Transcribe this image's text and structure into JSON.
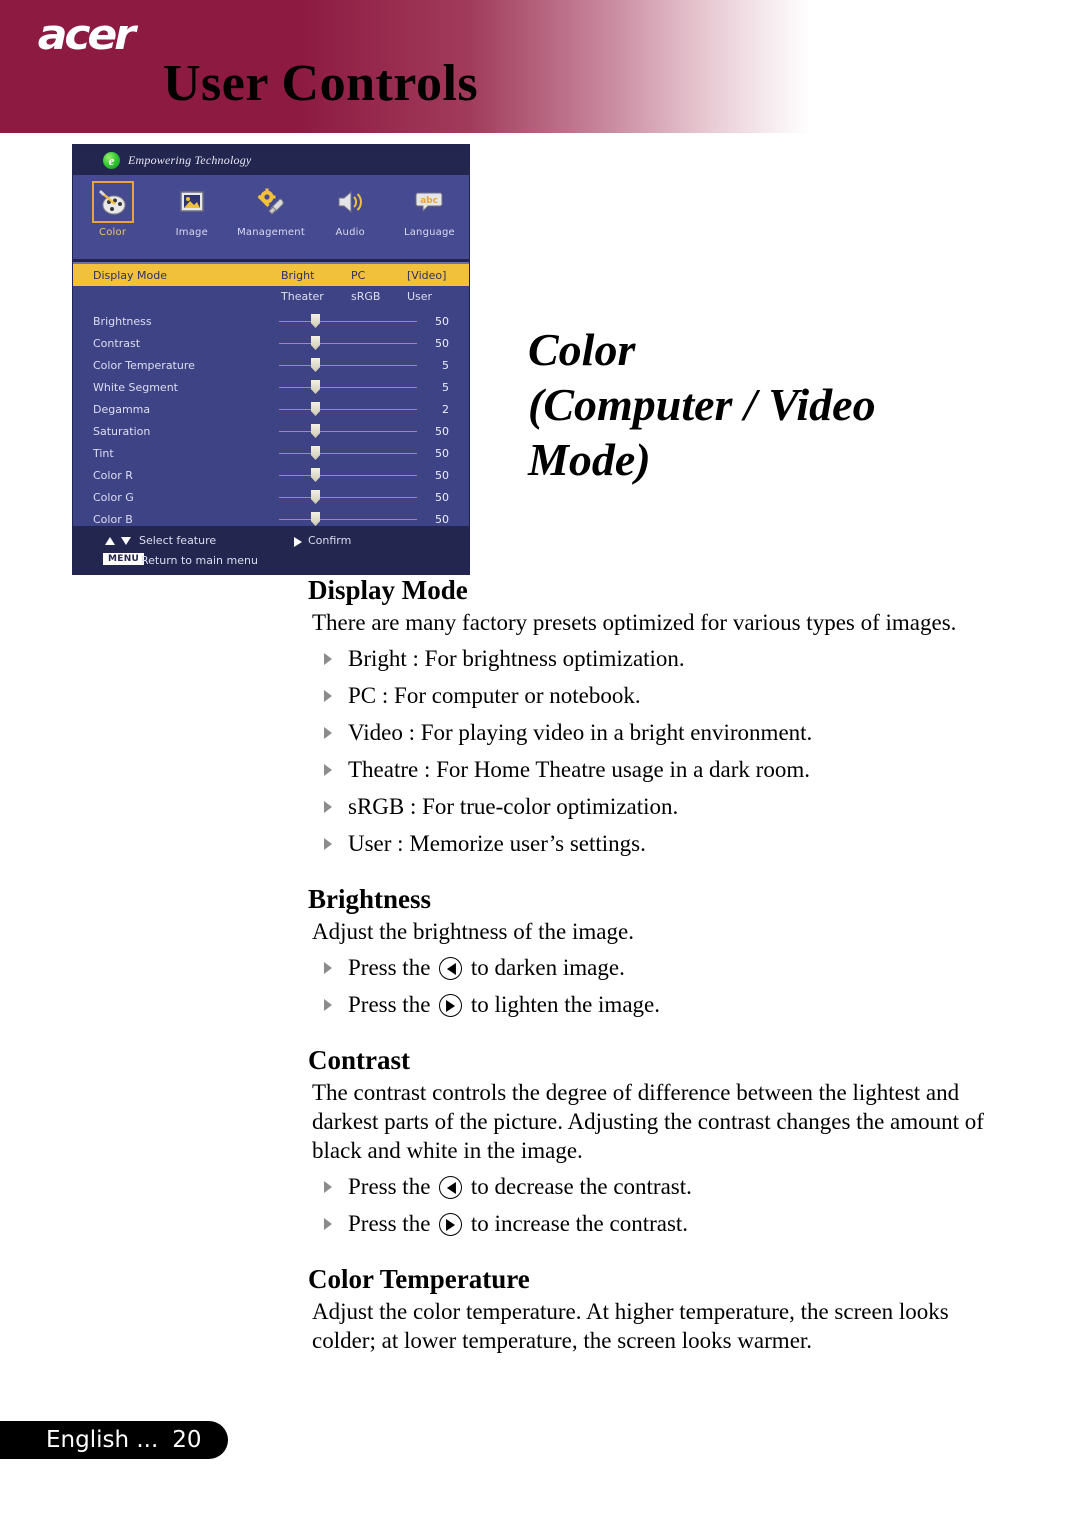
{
  "header": {
    "brand": "acer",
    "title": "User Controls"
  },
  "osd": {
    "brand_logo_letter": "e",
    "brand_text": "Empowering Technology",
    "tabs": [
      {
        "label": "Color",
        "icon": "palette-icon",
        "selected": true
      },
      {
        "label": "Image",
        "icon": "picture-icon",
        "selected": false
      },
      {
        "label": "Management",
        "icon": "gear-wrench-icon",
        "selected": false
      },
      {
        "label": "Audio",
        "icon": "speaker-icon",
        "selected": false
      },
      {
        "label": "Language",
        "icon": "abc-bubble-icon",
        "selected": false
      }
    ],
    "display_mode": {
      "label": "Display Mode",
      "options_row1": [
        "Bright",
        "PC",
        "[Video]"
      ],
      "options_row2": [
        "Theater",
        "sRGB",
        "User"
      ],
      "selected": "[Video]"
    },
    "sliders": [
      {
        "label": "Brightness",
        "value": "50"
      },
      {
        "label": "Contrast",
        "value": "50"
      },
      {
        "label": "Color Temperature",
        "value": "5"
      },
      {
        "label": "White Segment",
        "value": "5"
      },
      {
        "label": "Degamma",
        "value": "2"
      },
      {
        "label": "Saturation",
        "value": "50"
      },
      {
        "label": "Tint",
        "value": "50"
      },
      {
        "label": "Color R",
        "value": "50"
      },
      {
        "label": "Color G",
        "value": "50"
      },
      {
        "label": "Color B",
        "value": "50"
      }
    ],
    "footer": {
      "select_feature": "Select feature",
      "confirm": "Confirm",
      "menu_badge": "MENU",
      "return_main": "Return to main menu"
    },
    "colors": {
      "panel_bg": "#3e4386",
      "bar_bg": "#23264f",
      "highlight": "#f2c13c",
      "selection_border": "#e8a33d"
    }
  },
  "page_title": {
    "line1": "Color",
    "line2": "(Computer / Video",
    "line3": "Mode)"
  },
  "sections": [
    {
      "heading": "Display Mode",
      "paragraph": "There are many factory presets optimized for various types of images.",
      "bullets": [
        "Bright : For brightness optimization.",
        "PC : For computer or notebook.",
        "Video : For playing video in a bright environment.",
        "Theatre : For Home Theatre usage in a dark room.",
        "sRGB : For true-color optimization.",
        "User : Memorize user’s settings."
      ]
    },
    {
      "heading": "Brightness",
      "paragraph": "Adjust the brightness of the image.",
      "key_bullets": [
        {
          "pre": "Press the",
          "key": "left-arrow-key-icon",
          "post": "to darken image."
        },
        {
          "pre": "Press the",
          "key": "right-arrow-key-icon",
          "post": "to lighten the image."
        }
      ]
    },
    {
      "heading": "Contrast",
      "paragraph": "The contrast controls the degree of difference between the lightest and darkest parts of the picture. Adjusting the contrast changes the amount of black and white in the image.",
      "key_bullets": [
        {
          "pre": "Press the",
          "key": "left-arrow-key-icon",
          "post": "to decrease the contrast."
        },
        {
          "pre": "Press the",
          "key": "right-arrow-key-icon",
          "post": "to increase the contrast."
        }
      ]
    },
    {
      "heading": "Color Temperature",
      "paragraph": "Adjust the color temperature. At higher temperature, the screen looks colder; at lower temperature, the screen looks warmer."
    }
  ],
  "footer": {
    "language": "English ...",
    "page_number": "20"
  }
}
